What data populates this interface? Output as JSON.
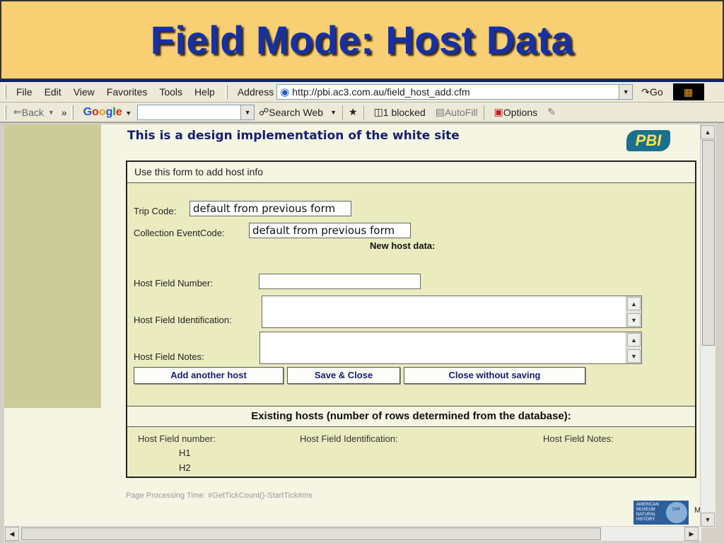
{
  "slide": {
    "title": "Field Mode: Host Data"
  },
  "menubar": {
    "items": [
      "File",
      "Edit",
      "View",
      "Favorites",
      "Tools",
      "Help"
    ],
    "address_label": "Address",
    "url": "http://pbi.ac3.com.au/field_host_add.cfm",
    "go_label": "Go"
  },
  "linksbar": {
    "back_label": "Back",
    "more_label": "»",
    "google": [
      "G",
      "o",
      "o",
      "g",
      "l",
      "e"
    ],
    "search_web_label": "Search Web",
    "blocked_label": "1 blocked",
    "autofill_label": "AutoFill",
    "options_label": "Options"
  },
  "page": {
    "headline": "This is a design implementation of the white site",
    "pbi_logo": "PBI",
    "form_header": "Use this form to add host info",
    "trip_code_label": "Trip Code:",
    "trip_code_value": "default from previous form",
    "collection_label": "Collection EventCode:",
    "collection_value": "default from previous form",
    "new_host_heading": "New host data:",
    "host_number_label": "Host Field Number:",
    "host_identification_label": "Host Field Identification:",
    "host_notes_label": "Host Field Notes:",
    "buttons": {
      "add_another": "Add another host",
      "save_close": "Save & Close",
      "close_no_save": "Close without saving"
    },
    "existing_heading": "Existing hosts (number of rows determined from the database):",
    "columns": [
      "Host Field number:",
      "Host Field Identification:",
      "Host Field Notes:"
    ],
    "hosts": [
      "H1",
      "H2"
    ],
    "processing_time": "Page Processing Time: #GetTickCount()-StartTick#ms",
    "amnh_logo": [
      "AMERICAN",
      "MUSEUM",
      "NATURAL",
      "HISTORY"
    ],
    "corner_label": "M"
  }
}
